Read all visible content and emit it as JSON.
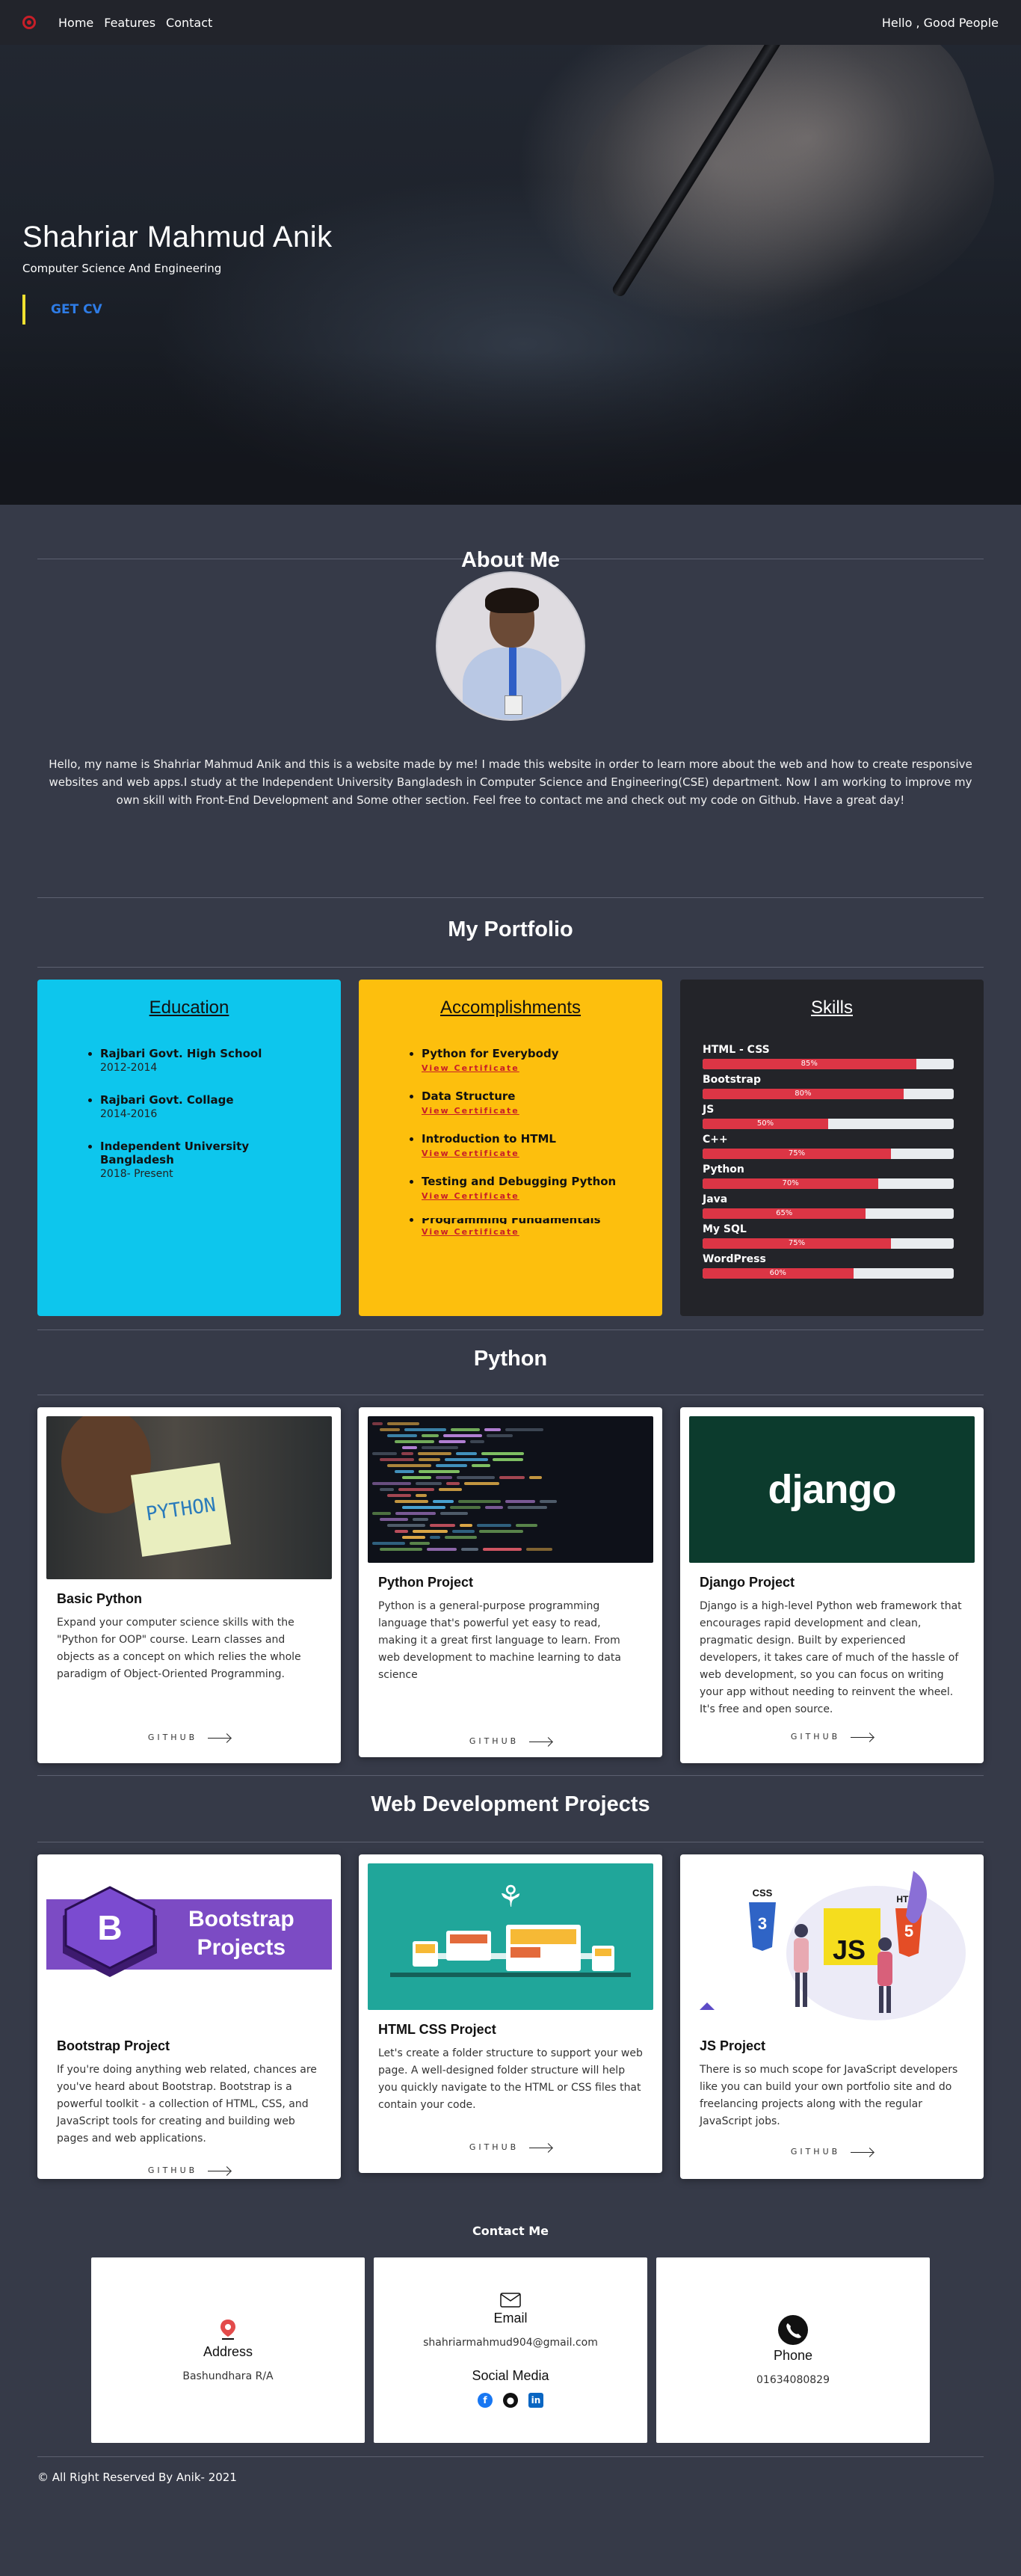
{
  "nav": {
    "links": [
      "Home",
      "Features",
      "Contact"
    ],
    "greeting": "Hello , Good People"
  },
  "hero": {
    "name": "Shahriar Mahmud Anik",
    "subtitle": "Computer Science And Engineering",
    "cta": "GET CV"
  },
  "about": {
    "title": "About Me",
    "text": "Hello, my name is Shahriar Mahmud Anik and this is a website made by me! I made this website in order to learn more about the web and how to create responsive websites and web apps.I study at the Independent University Bangladesh in Computer Science and Engineering(CSE) department. Now I am working to improve my own skill with Front-End Development and Some other section. Feel free to contact me and check out my code on Github. Have a great day!"
  },
  "portfolio": {
    "title": "My Portfolio",
    "education": {
      "title": "Education",
      "items": [
        {
          "school": "Rajbari Govt. High School",
          "years": "2012-2014"
        },
        {
          "school": "Rajbari Govt. Collage",
          "years": "2014-2016"
        },
        {
          "school": "Independent University Bangladesh",
          "years": "2018- Present"
        }
      ]
    },
    "accomplishments": {
      "title": "Accomplishments",
      "link_label": "View Certificate",
      "items": [
        "Python for Everybody",
        "Data Structure",
        "Introduction to HTML",
        "Testing and Debugging Python",
        "Programming Fundamentals"
      ]
    },
    "skills": {
      "title": "Skills",
      "items": [
        {
          "name": "HTML - CSS",
          "percent": 85
        },
        {
          "name": "Bootstrap",
          "percent": 80
        },
        {
          "name": "JS",
          "percent": 50
        },
        {
          "name": "C++",
          "percent": 75
        },
        {
          "name": "Python",
          "percent": 70
        },
        {
          "name": "Java",
          "percent": 65
        },
        {
          "name": "My SQL",
          "percent": 75
        },
        {
          "name": "WordPress",
          "percent": 60
        }
      ]
    }
  },
  "python": {
    "title": "Python",
    "cards": [
      {
        "title": "Basic Python",
        "text": "Expand your computer science skills with the \"Python for OOP\" course. Learn classes and objects as a concept on which relies the whole paradigm of Object-Oriented Programming.",
        "link": "GITHUB",
        "image_text": "PYTHON"
      },
      {
        "title": "Python Project",
        "text": "Python is a general-purpose programming language that's powerful yet easy to read, making it a great first language to learn. From web development to machine learning to data science",
        "link": "GITHUB"
      },
      {
        "title": "Django Project",
        "text": "Django is a high-level Python web framework that encourages rapid development and clean, pragmatic design. Built by experienced developers, it takes care of much of the hassle of web development, so you can focus on writing your app without needing to reinvent the wheel. It's free and open source.",
        "link": "GITHUB",
        "image_text": "django"
      }
    ]
  },
  "web": {
    "title": "Web Development Projects",
    "cards": [
      {
        "title": "Bootstrap Project",
        "text": "If you're doing anything web related, chances are you've heard about Bootstrap. Bootstrap is a powerful toolkit - a collection of HTML, CSS, and JavaScript tools for creating and building web pages and web applications.",
        "link": "GITHUB",
        "image_line1": "Bootstrap",
        "image_line2": "Projects"
      },
      {
        "title": "HTML CSS Project",
        "text": "Let's create a folder structure to support your web page. A well-designed folder structure will help you quickly navigate to the HTML or CSS files that contain your code.",
        "link": "GITHUB"
      },
      {
        "title": "JS Project",
        "text": "There is so much scope for JavaScript developers like you can build your own portfolio site and do freelancing projects along with the regular JavaScript jobs.",
        "link": "GITHUB",
        "image_badges": [
          "CSS",
          "JS",
          "HTML"
        ]
      }
    ]
  },
  "contact": {
    "title": "Contact Me",
    "address": {
      "label": "Address",
      "value": "Bashundhara R/A"
    },
    "email": {
      "label": "Email",
      "value": "shahriarmahmud904@gmail.com",
      "social_label": "Social Media"
    },
    "phone": {
      "label": "Phone",
      "value": "01634080829"
    }
  },
  "footer": {
    "text": "© All Right Reserved By Anik- 2021"
  },
  "colors": {
    "accent": "#dc3545",
    "education": "#0dc6ed",
    "accomplishments": "#fdbf0d",
    "skills": "#232429",
    "background": "#363a48"
  }
}
